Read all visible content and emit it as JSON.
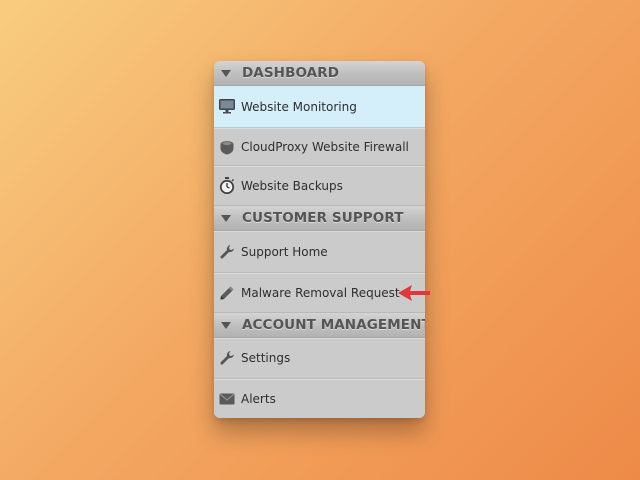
{
  "sections": [
    {
      "title": "DASHBOARD",
      "items": [
        {
          "label": "Website Monitoring",
          "icon": "monitor-icon",
          "active": true
        },
        {
          "label": "CloudProxy Website Firewall",
          "icon": "firewall-shield-icon"
        },
        {
          "label": "Website Backups",
          "icon": "stopwatch-icon"
        }
      ]
    },
    {
      "title": "CUSTOMER SUPPORT",
      "items": [
        {
          "label": "Support Home",
          "icon": "wrench-icon"
        },
        {
          "label": "Malware Removal Request",
          "icon": "pencil-icon",
          "highlighted_by_arrow": true
        }
      ]
    },
    {
      "title": "ACCOUNT MANAGEMENT",
      "items": [
        {
          "label": "Settings",
          "icon": "wrench-icon"
        },
        {
          "label": "Alerts",
          "icon": "envelope-icon"
        }
      ]
    }
  ],
  "colors": {
    "background_start": "#f8cd80",
    "background_end": "#ee8a48",
    "panel": "#cbcbcb",
    "active_item": "#d4eefa",
    "arrow": "#e0383a"
  },
  "annotation": {
    "icon": "red-arrow-icon"
  }
}
